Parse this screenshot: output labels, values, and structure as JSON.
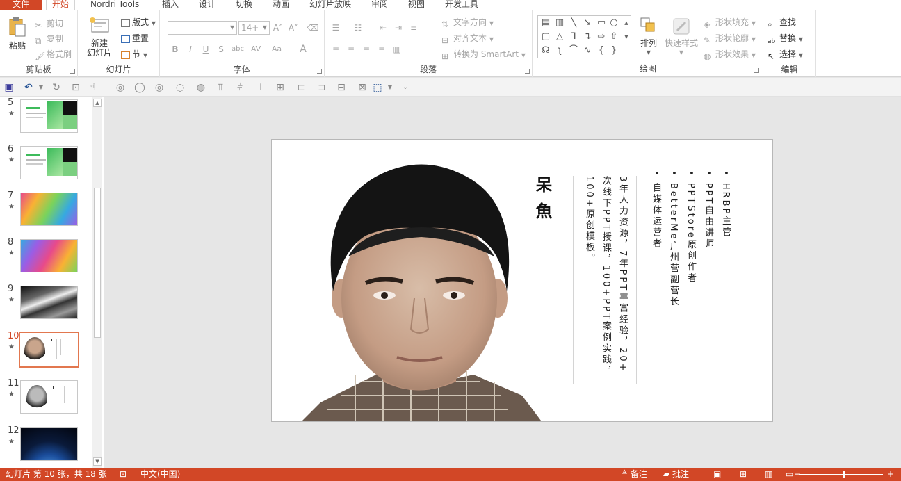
{
  "tabs": {
    "file": "文件",
    "items": [
      "开始",
      "Nordri Tools",
      "插入",
      "设计",
      "切换",
      "动画",
      "幻灯片放映",
      "审阅",
      "视图",
      "开发工具"
    ],
    "active": "开始"
  },
  "ribbon": {
    "clipboard": {
      "label": "剪贴板",
      "paste": "粘贴",
      "cut": "剪切",
      "copy": "复制",
      "format_painter": "格式刷"
    },
    "slides": {
      "label": "幻灯片",
      "new_slide_1": "新建",
      "new_slide_2": "幻灯片",
      "layout": "版式",
      "reset": "重置",
      "section": "节"
    },
    "font": {
      "label": "字体",
      "font_name": "",
      "font_size": "14+",
      "bold": "B",
      "italic": "I",
      "underline": "U",
      "shadow": "S",
      "strike": "abc",
      "spacing": "AV",
      "case": "Aa",
      "color": "A"
    },
    "paragraph": {
      "label": "段落",
      "text_direction": "文字方向",
      "align_text": "对齐文本",
      "smartart": "转换为 SmartArt"
    },
    "drawing": {
      "label": "绘图",
      "arrange": "排列",
      "quick_styles": "快速样式",
      "fill": "形状填充",
      "outline": "形状轮廓",
      "effects": "形状效果"
    },
    "editing": {
      "label": "编辑",
      "find": "查找",
      "replace": "替换",
      "select": "选择"
    }
  },
  "thumbnails": [
    {
      "num": "5",
      "star": "★",
      "style": "green"
    },
    {
      "num": "6",
      "star": "★",
      "style": "green"
    },
    {
      "num": "7",
      "star": "★",
      "style": "rainbow"
    },
    {
      "num": "8",
      "star": "★",
      "style": "rainbow"
    },
    {
      "num": "9",
      "star": "★",
      "style": "dark"
    },
    {
      "num": "10",
      "star": "★",
      "style": "portrait",
      "active": true
    },
    {
      "num": "11",
      "star": "★",
      "style": "portrait-bw"
    },
    {
      "num": "12",
      "star": "★",
      "style": "earth"
    }
  ],
  "slide": {
    "name": "呆魚",
    "bullets": [
      "HRBP主管",
      "PPT自由讲师",
      "PPTStore原创作者",
      "BetterMe广州营副营长",
      "自媒体运营者"
    ],
    "bio_lines": [
      "3年人力资源，7年PPT丰富经验，20+",
      "次线下PPT授课，100+PPT案例实践，",
      "100+原创模板。"
    ],
    "bullet_char": "•"
  },
  "status": {
    "slide_info": "幻灯片 第 10 张，共 18 张",
    "language": "中文(中国)",
    "notes": "备注",
    "comments": "批注"
  },
  "colors": {
    "accent": "#d24726",
    "thumb_active_border": "#e2774f"
  }
}
